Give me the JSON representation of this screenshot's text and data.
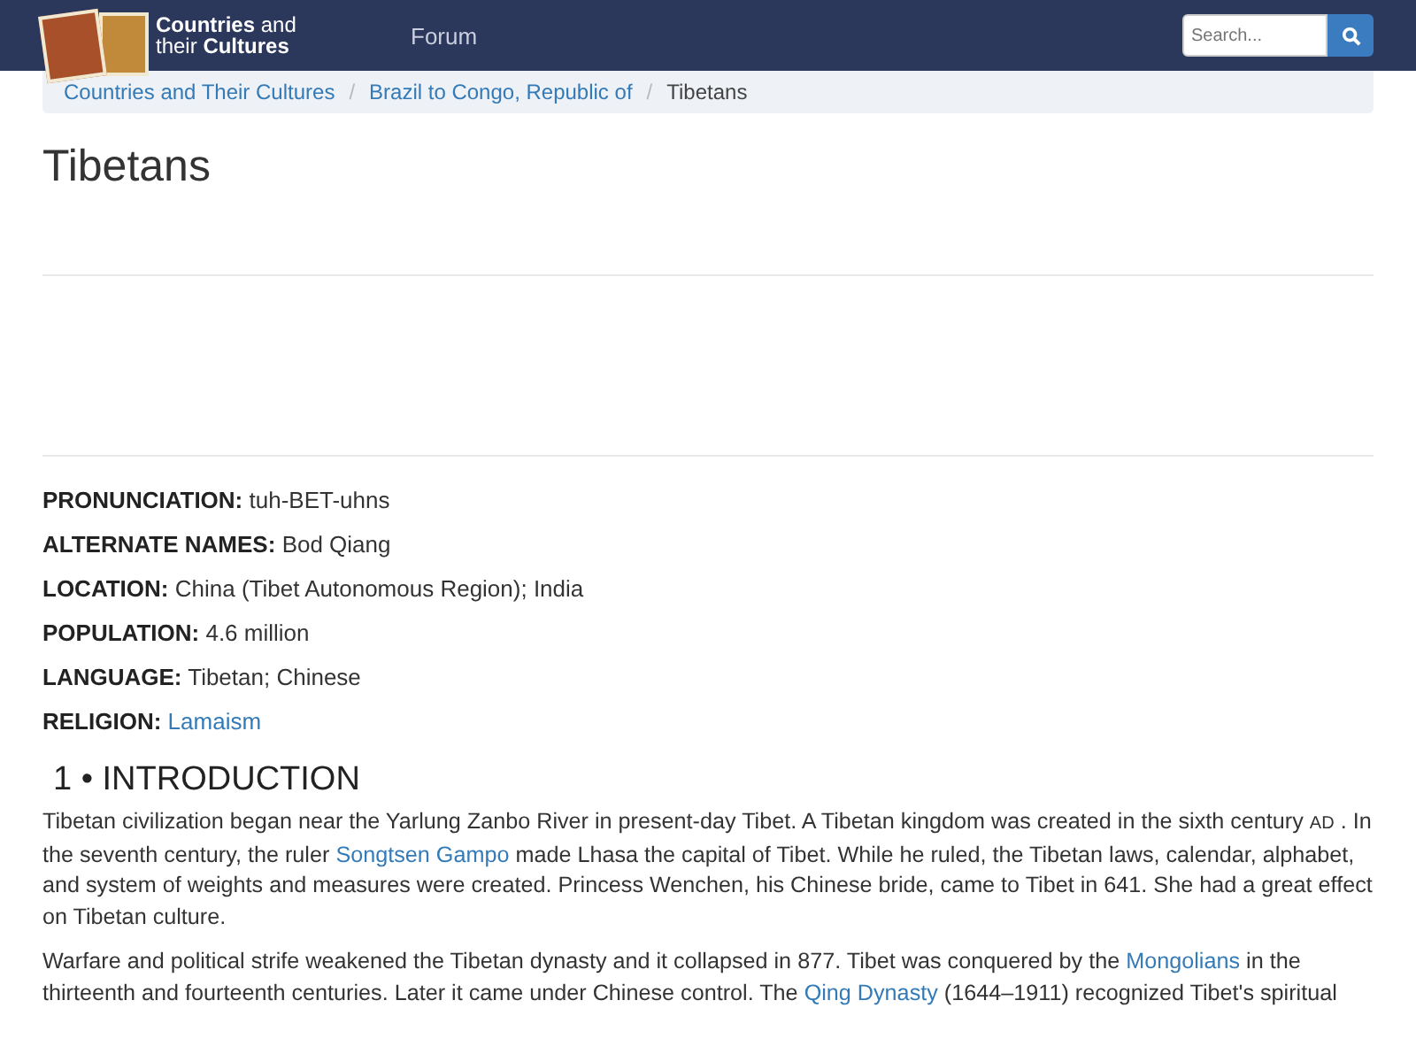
{
  "navbar": {
    "logo_lines": [
      "**Countries** and",
      "their **Cultures**"
    ],
    "links": [
      "Forum"
    ],
    "search": {
      "placeholder": "Search..."
    }
  },
  "breadcrumb_separator": "/",
  "breadcrumb": [
    {
      "label": "Countries and Their Cultures",
      "current": false
    },
    {
      "label": "Brazil to Congo, Republic of",
      "current": false
    },
    {
      "label": "Tibetans",
      "current": true
    }
  ],
  "title": "Tibetans",
  "facts": [
    {
      "label": "PRONUNCIATION:",
      "value": "tuh-BET-uhns",
      "link": false
    },
    {
      "label": "ALTERNATE NAMES:",
      "value": "Bod Qiang",
      "link": false
    },
    {
      "label": "LOCATION:",
      "value": "China (Tibet Autonomous Region); India",
      "link": false
    },
    {
      "label": "POPULATION:",
      "value": "4.6 million",
      "link": false
    },
    {
      "label": "LANGUAGE:",
      "value": "Tibetan; Chinese",
      "link": false
    },
    {
      "label": "RELIGION:",
      "value": "Lamaism",
      "link": true
    }
  ],
  "section_heading": "1 • INTRODUCTION",
  "paragraphs": [
    [
      {
        "kind": "text",
        "text": "Tibetan civilization began near the Yarlung Zanbo River in present-day Tibet. A Tibetan kingdom was created in the sixth century "
      },
      {
        "kind": "smallcaps",
        "text": "AD"
      },
      {
        "kind": "text",
        "text": " . In the seventh century, the ruler "
      },
      {
        "kind": "link",
        "text": "Songtsen Gampo"
      },
      {
        "kind": "text",
        "text": " made Lhasa the capital of Tibet. While he ruled, the Tibetan laws, calendar, alphabet, and system of weights and measures were created. Princess Wenchen, his Chinese bride, came to Tibet in 641. She had a great effect on Tibetan culture."
      }
    ],
    [
      {
        "kind": "text",
        "text": "Warfare and political strife weakened the Tibetan dynasty and it collapsed in 877. Tibet was conquered by the "
      },
      {
        "kind": "link",
        "text": "Mongolians"
      },
      {
        "kind": "text",
        "text": " in the thirteenth and fourteenth centuries. Later it came under Chinese control. The "
      },
      {
        "kind": "link",
        "text": "Qing Dynasty"
      },
      {
        "kind": "text",
        "text": " (1644–1911) recognized Tibet's spiritual"
      }
    ]
  ]
}
